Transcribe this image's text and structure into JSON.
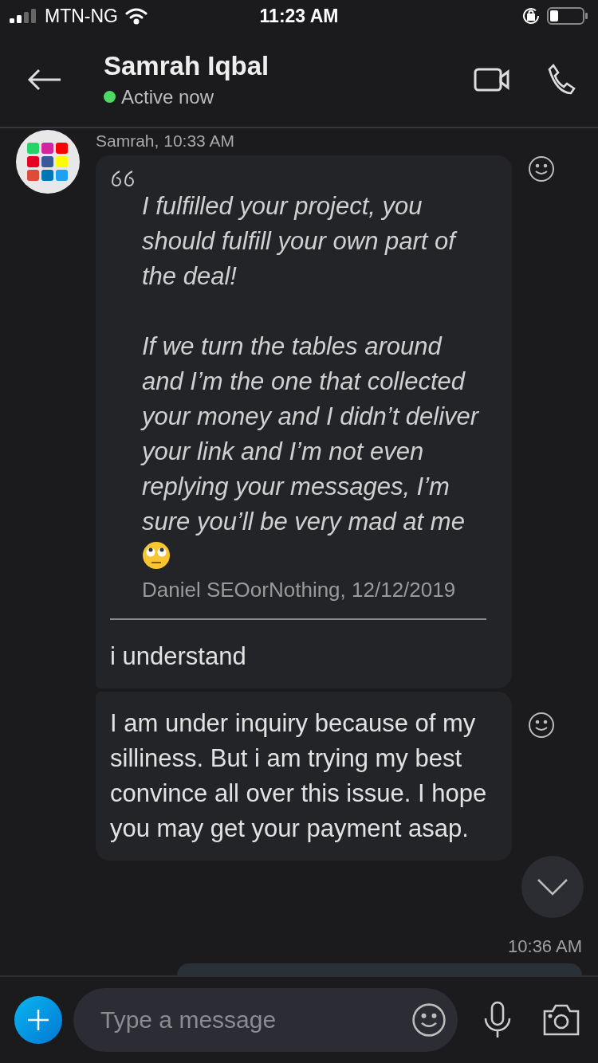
{
  "status_bar": {
    "carrier": "MTN-NG",
    "time": "11:23 AM"
  },
  "header": {
    "name": "Samrah Iqbal",
    "status": "Active now",
    "online": true
  },
  "messages": [
    {
      "sender_line": "Samrah, 10:33 AM",
      "quote": {
        "paragraphs": [
          "I fulfilled your project, you should fulfill your own part of the deal!",
          "If we turn the tables around and I’m the one that collected your money and I didn’t deliver your link and I’m not even replying your messages, I’m sure you’ll be very mad at me"
        ],
        "attribution": "Daniel SEOorNothing, 12/12/2019"
      },
      "text": "i understand"
    },
    {
      "text": "I am under inquiry because of my silliness. But i am trying my best convince all over this issue. I hope you may get your payment asap."
    }
  ],
  "timestamp": "10:36 AM",
  "composer": {
    "placeholder": "Type a message"
  }
}
